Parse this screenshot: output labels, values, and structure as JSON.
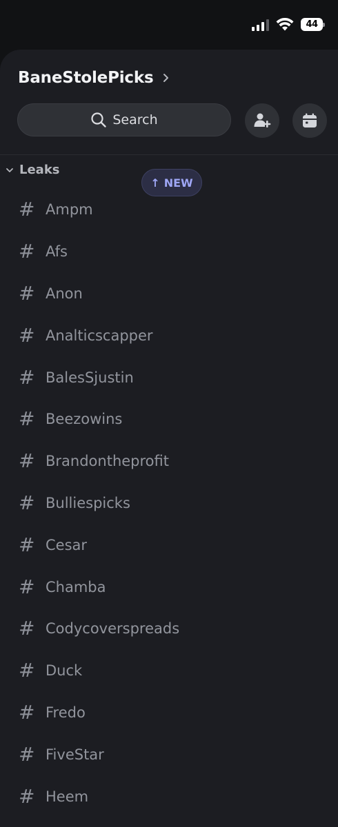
{
  "status_bar": {
    "battery": "44"
  },
  "server": {
    "name": "BaneStolePicks"
  },
  "search": {
    "label": "Search"
  },
  "category": {
    "label": "Leaks"
  },
  "new_pill": {
    "arrow": "↑",
    "label": "NEW"
  },
  "channels": [
    "Ampm",
    "Afs",
    "Anon",
    "Analticscapper",
    "BalesSjustin",
    "Beezowins",
    "Brandontheprofit",
    "Bulliespicks",
    "Cesar",
    "Chamba",
    "Codycoverspreads",
    "Duck",
    "Fredo",
    "FiveStar",
    "Heem"
  ],
  "colors": {
    "background": "#111214",
    "panel": "#1c1d22",
    "button": "#2f3136",
    "channel_text": "#92959d",
    "new_pill_text": "#9ea6f5"
  }
}
